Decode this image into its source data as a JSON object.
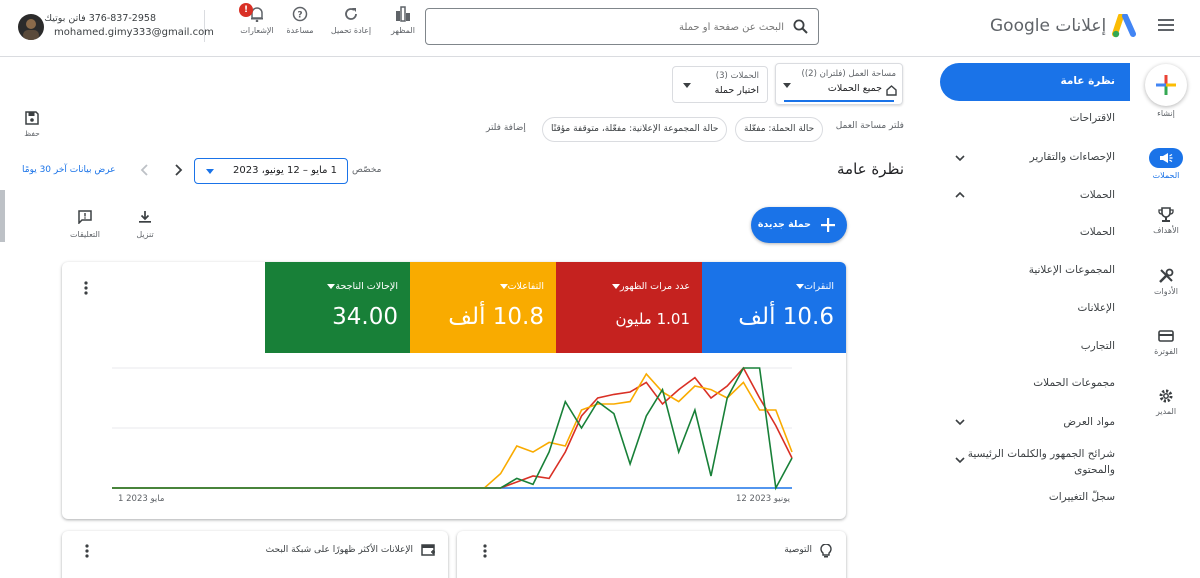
{
  "header": {
    "product_name": "إعلانات Google",
    "search_placeholder": "البحث عن صفحة أو حملة",
    "buttons": [
      {
        "label": "المظهر",
        "icon": "appearance-icon"
      },
      {
        "label": "إعادة تحميل",
        "icon": "refresh-icon"
      },
      {
        "label": "مساعدة",
        "icon": "help-icon"
      },
      {
        "label": "الإشعارات",
        "icon": "notifications-icon"
      }
    ],
    "notification_badge": "!",
    "account_phone": "376-837-2958 فاتن بوتيك",
    "account_email": "mohamed.gimy333@gmail.com"
  },
  "rail": {
    "create_label": "إنشاء",
    "items": [
      {
        "label": "الحملات",
        "icon": "campaigns-icon"
      },
      {
        "label": "الأهداف",
        "icon": "goals-icon"
      },
      {
        "label": "الأدوات",
        "icon": "tools-icon"
      },
      {
        "label": "الفوترة",
        "icon": "billing-icon"
      },
      {
        "label": "المدير",
        "icon": "admin-icon"
      }
    ]
  },
  "sidebar": {
    "items": [
      {
        "label": "نظرة عامة",
        "active": true
      },
      {
        "label": "الاقتراحات"
      },
      {
        "label": "الإحصاءات والتقارير",
        "chevron": "down"
      },
      {
        "label": "الحملات",
        "chevron": "up"
      },
      {
        "label": "الحملات"
      },
      {
        "label": "المجموعات الإعلانية"
      },
      {
        "label": "الإعلانات"
      },
      {
        "label": "التجارب"
      },
      {
        "label": "مجموعات الحملات"
      },
      {
        "label": "مواد العرض",
        "chevron": "down"
      },
      {
        "label": "شرائح الجمهور والكلمات الرئيسية والمحتوى",
        "chevron": "down"
      },
      {
        "label": "سجلّ التغييرات"
      }
    ]
  },
  "main": {
    "workspace_label": "مساحة العمل (فلتران (2))",
    "workspace_value": "جميع الحملات",
    "campaigns_label": "الحملات (3)",
    "campaigns_value": "اختيار حملة",
    "filter_label": "فلتر مساحة العمل",
    "filters": [
      "حالة الحملة: مفعّلة",
      "حالة المجموعة الإعلانية: مفعّلة، متوقفة مؤقتًا"
    ],
    "add_filter": "إضافة فلتر",
    "save_label": "حفظ",
    "page_title": "نظرة عامة",
    "date_custom": "مخصّص",
    "date_range": "1 مايو – 12 يونيو، 2023",
    "show_last_30": "عرض بيانات آخر 30 يومًا",
    "download_label": "تنزيل",
    "comments_label": "التعليقات",
    "new_campaign": "حملة جديدة"
  },
  "metrics": [
    {
      "label": "النقرات",
      "value": "10.6 ألف",
      "color": "#1a73e8"
    },
    {
      "label": "عدد مرات الظهور",
      "value": "1.01 مليون",
      "color": "#c5221f"
    },
    {
      "label": "التفاعلات",
      "value": "10.8 ألف",
      "color": "#f9ab00"
    },
    {
      "label": "الإحالات الناجحة",
      "value": "34.00",
      "color": "#188038"
    }
  ],
  "chart_data": {
    "type": "line",
    "x_start_label": "1 مايو 2023",
    "x_end_label": "12 يونيو 2023",
    "series": [
      {
        "color": "#1a73e8",
        "values": [
          0,
          0,
          0,
          0,
          0,
          0,
          0,
          0,
          0,
          0,
          0,
          0,
          0,
          0,
          0,
          0,
          0,
          0,
          0,
          0,
          0,
          0,
          0,
          0,
          0,
          0,
          0,
          0,
          0,
          0,
          0,
          0,
          0,
          0,
          0,
          0,
          0,
          0,
          0,
          0,
          0,
          0,
          0
        ]
      },
      {
        "color": "#d93025",
        "values": [
          0,
          0,
          0,
          0,
          0,
          0,
          0,
          0,
          0,
          0,
          0,
          0,
          0,
          0,
          0,
          0,
          0,
          0,
          0,
          0,
          0,
          0,
          0,
          0,
          0,
          0.05,
          0.1,
          0.08,
          0.3,
          0.6,
          0.75,
          0.78,
          0.8,
          0.88,
          0.7,
          0.82,
          0.92,
          0.75,
          0.85,
          1.0,
          0.75,
          0.52,
          0.25
        ]
      },
      {
        "color": "#f9ab00",
        "values": [
          0,
          0,
          0,
          0,
          0,
          0,
          0,
          0,
          0,
          0,
          0,
          0,
          0,
          0,
          0,
          0,
          0,
          0,
          0,
          0,
          0,
          0,
          0,
          0,
          0.12,
          0.35,
          0.3,
          0.38,
          0.35,
          0.65,
          0.7,
          0.7,
          0.72,
          0.95,
          0.8,
          0.72,
          0.85,
          0.82,
          0.75,
          0.88,
          0.65,
          0.65,
          0.3
        ]
      },
      {
        "color": "#188038",
        "values": [
          0,
          0,
          0,
          0,
          0,
          0,
          0,
          0,
          0,
          0,
          0,
          0,
          0,
          0,
          0,
          0,
          0,
          0,
          0,
          0,
          0,
          0,
          0,
          0,
          0,
          0.08,
          0.03,
          0.3,
          0.72,
          0.5,
          0.72,
          0.62,
          0.2,
          0.6,
          0.82,
          0.3,
          0.65,
          0.1,
          0.75,
          1.0,
          1.0,
          0.0,
          0.25
        ]
      }
    ]
  },
  "lower_cards": [
    {
      "title": "الإعلانات الأكثر ظهورًا على شبكة البحث",
      "icon": "ad-preview-icon"
    },
    {
      "title": "التوصية",
      "icon": "lightbulb-icon"
    }
  ]
}
